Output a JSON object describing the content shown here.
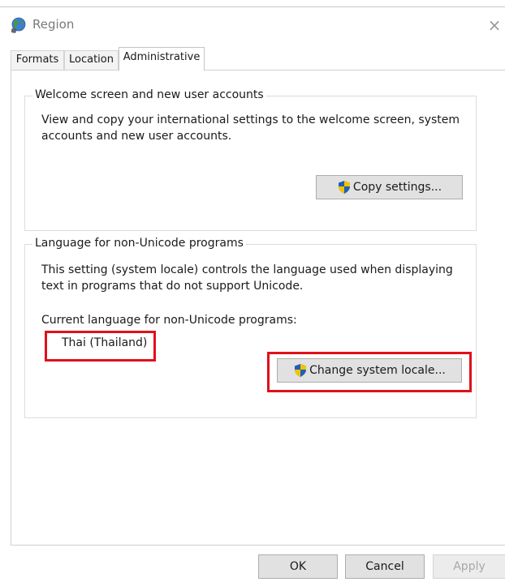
{
  "window": {
    "title": "Region",
    "close_glyph": "×",
    "icon": "globe-icon"
  },
  "tabs": [
    {
      "label": "Formats",
      "active": false
    },
    {
      "label": "Location",
      "active": false
    },
    {
      "label": "Administrative",
      "active": true
    }
  ],
  "welcome_group": {
    "title": "Welcome screen and new user accounts",
    "description_line1": "View and copy your international settings to the welcome screen, system",
    "description_line2": "accounts and new user accounts.",
    "copy_button_label": "Copy settings...",
    "button_icon": "uac-shield-icon"
  },
  "language_group": {
    "title": "Language for non-Unicode programs",
    "description_line1": "This setting (system locale) controls the language used when displaying",
    "description_line2": "text in programs that do not support Unicode.",
    "current_label": "Current language for non-Unicode programs:",
    "current_value": "Thai (Thailand)",
    "change_button_label": "Change system locale...",
    "button_icon": "uac-shield-icon"
  },
  "footer": {
    "ok_label": "OK",
    "cancel_label": "Cancel",
    "apply_label": "Apply",
    "apply_enabled": false
  },
  "colors": {
    "highlight": "#e0101a",
    "button_face": "#e1e1e1",
    "shield_blue": "#1f5fb4",
    "shield_yellow": "#f2c200"
  }
}
